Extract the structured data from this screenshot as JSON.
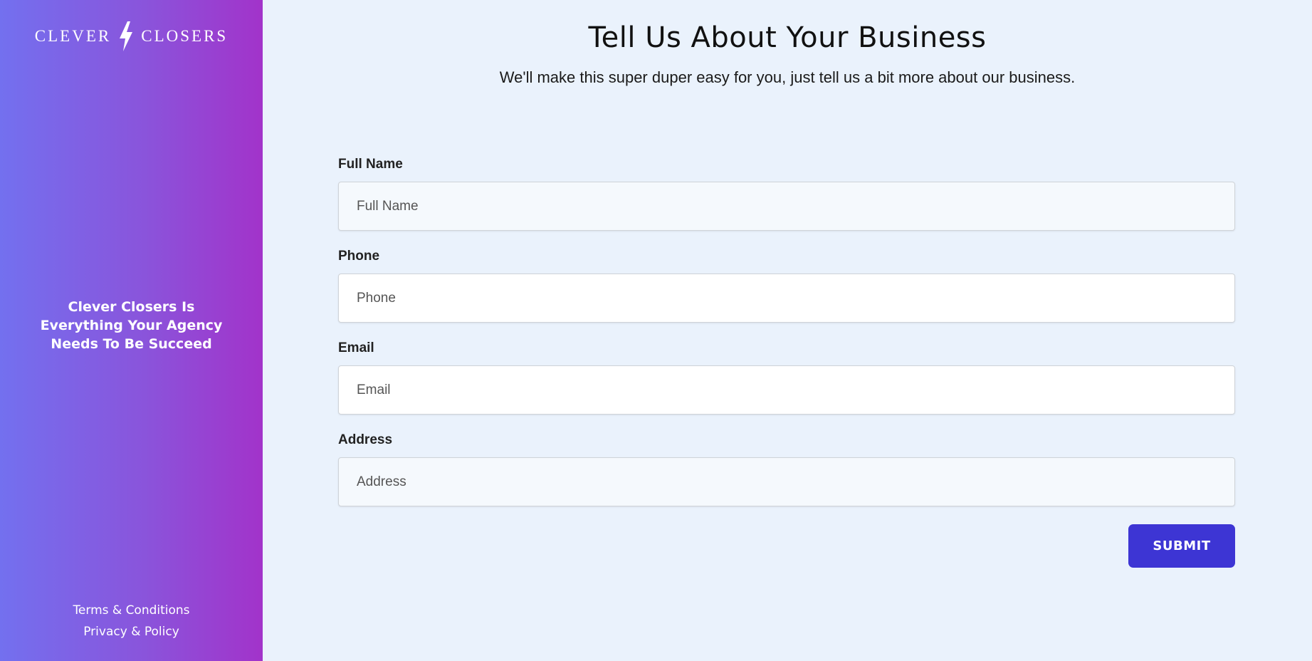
{
  "brand": {
    "left_word": "CLEVER",
    "right_word": "CLOSERS",
    "icon": "lightning-bolt-icon"
  },
  "sidebar": {
    "tagline": "Clever Closers Is Everything Your Agency Needs To Be Succeed",
    "links": {
      "terms": "Terms & Conditions",
      "privacy": "Privacy & Policy"
    }
  },
  "main": {
    "title": "Tell Us About Your Business",
    "subtitle": "We'll make this super duper easy for you, just tell us a bit more about our business."
  },
  "form": {
    "full_name": {
      "label": "Full Name",
      "placeholder": "Full Name",
      "value": ""
    },
    "phone": {
      "label": "Phone",
      "placeholder": "Phone",
      "value": ""
    },
    "email": {
      "label": "Email",
      "placeholder": "Email",
      "value": ""
    },
    "address": {
      "label": "Address",
      "placeholder": "Address",
      "value": ""
    },
    "submit_label": "SUBMIT"
  },
  "colors": {
    "sidebar_gradient_start": "#7370ef",
    "sidebar_gradient_end": "#a233ca",
    "main_background": "#eaf2fc",
    "submit_button": "#3d35d4"
  }
}
